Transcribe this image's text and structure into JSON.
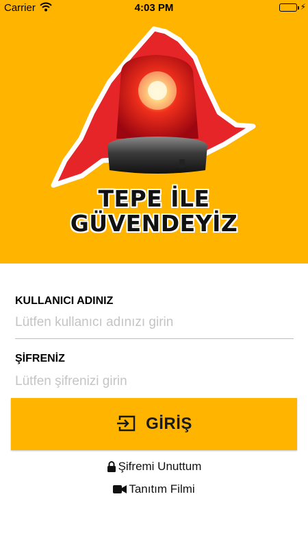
{
  "status_bar": {
    "carrier": "Carrier",
    "time": "4:03 PM",
    "icons": [
      "wifi-icon",
      "battery-icon",
      "charging-bolt-icon"
    ],
    "battery_level": 1.0
  },
  "hero": {
    "logo_line1": "TEPE İLE",
    "logo_line2": "GÜVENDEYİZ",
    "colors": {
      "background": "#FFB400",
      "cape": "#E52528",
      "siren": "#E8101A"
    }
  },
  "form": {
    "username": {
      "label": "KULLANICI ADINIZ",
      "placeholder": "Lütfen kullanıcı adınızı girin",
      "value": ""
    },
    "password": {
      "label": "ŞİFRENİZ",
      "placeholder": "Lütfen şifrenizi girin",
      "value": ""
    }
  },
  "login_button": {
    "label": "GİRİŞ",
    "icon": "login-icon",
    "color": "#FFB400"
  },
  "links": {
    "forgot_password": {
      "label": "Şifremi Unuttum",
      "icon": "lock-icon"
    },
    "intro_video": {
      "label": "Tanıtım Filmi",
      "icon": "video-camera-icon"
    }
  }
}
